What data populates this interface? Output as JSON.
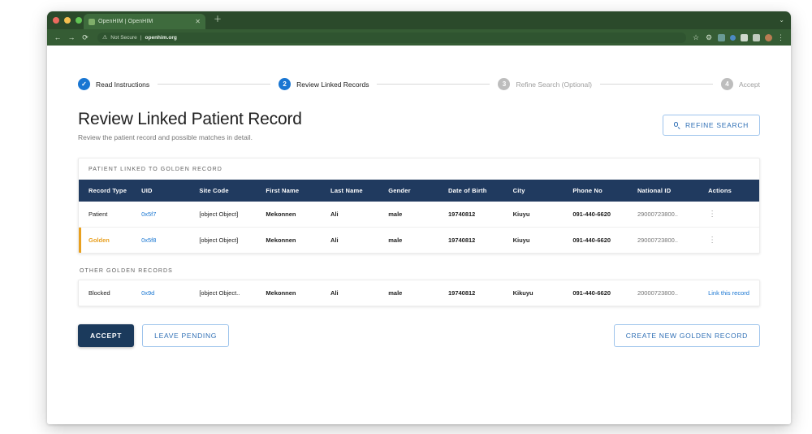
{
  "browser": {
    "tab_title": "OpenHIM | OpenHIM",
    "tab_close_icon": "close-icon",
    "new_tab_icon": "plus-icon",
    "back_icon": "←",
    "forward_icon": "→",
    "reload_icon": "⟳",
    "security_icon": "warning-triangle-icon",
    "security_label": "Not Secure",
    "url": "openhim.org",
    "menu_icon": "⋮",
    "window_controls": [
      "close",
      "minimize",
      "maximize"
    ]
  },
  "stepper": {
    "steps": [
      {
        "index": "✓",
        "label": "Read Instructions",
        "state": "done"
      },
      {
        "index": "2",
        "label": "Review Linked Records",
        "state": "active"
      },
      {
        "index": "3",
        "label": "Refine Search (Optional)",
        "state": "idle"
      },
      {
        "index": "4",
        "label": "Accept",
        "state": "idle"
      }
    ]
  },
  "header": {
    "title": "Review Linked Patient Record",
    "subtitle": "Review the patient record and possible matches in detail.",
    "refine_button": "REFINE SEARCH"
  },
  "linked_table": {
    "caption": "PATIENT LINKED TO GOLDEN RECORD",
    "columns": [
      "Record Type",
      "UID",
      "Site Code",
      "First Name",
      "Last Name",
      "Gender",
      "Date of Birth",
      "City",
      "Phone No",
      "National ID",
      "Actions"
    ],
    "rows": [
      {
        "record_type": "Patient",
        "uid": "0x5f7",
        "site_code": "[object Object]",
        "first_name": "Mekonnen",
        "last_name": "Ali",
        "gender": "male",
        "dob": "19740812",
        "city": "Kiuyu",
        "phone": "091-440-6620",
        "national_id": "29000723800..",
        "action": "⋮"
      },
      {
        "record_type": "Golden",
        "uid": "0x5f8",
        "site_code": "[object Object]",
        "first_name": "Mekonnen",
        "last_name": "Ali",
        "gender": "male",
        "dob": "19740812",
        "city": "Kiuyu",
        "phone": "091-440-6620",
        "national_id": "29000723800..",
        "action": "⋮"
      }
    ]
  },
  "other_table": {
    "caption": "OTHER GOLDEN RECORDS",
    "rows": [
      {
        "record_type": "Blocked",
        "uid": "0x9d",
        "site_code": "[object Object..",
        "first_name": "Mekonnen",
        "last_name": "Ali",
        "gender": "male",
        "dob": "19740812",
        "city": "Kikuyu",
        "phone": "091-440-6620",
        "national_id": "20000723800..",
        "action": "Link this record"
      }
    ]
  },
  "footer": {
    "accept": "ACCEPT",
    "leave_pending": "LEAVE PENDING",
    "create_new": "CREATE NEW GOLDEN RECORD"
  },
  "colors": {
    "accent_blue": "#1976d2",
    "table_header": "#203a5f",
    "golden": "#e8a020",
    "accept_button": "#1b3a5c"
  }
}
